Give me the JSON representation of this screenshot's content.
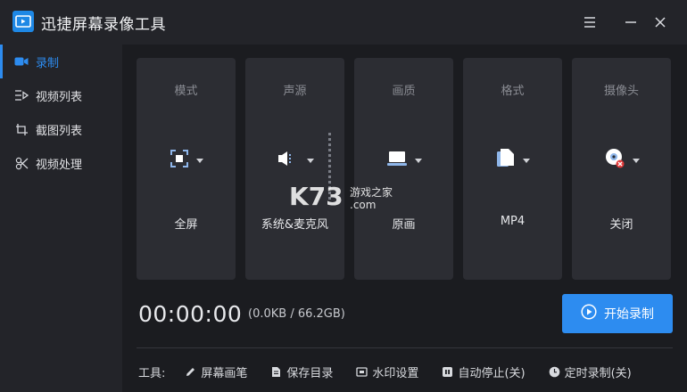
{
  "app": {
    "title": "迅捷屏幕录像工具"
  },
  "sidebar": {
    "items": [
      {
        "label": "录制",
        "icon": "video-camera-icon",
        "active": true
      },
      {
        "label": "视频列表",
        "icon": "video-list-icon",
        "active": false
      },
      {
        "label": "截图列表",
        "icon": "screenshot-list-icon",
        "active": false
      },
      {
        "label": "视频处理",
        "icon": "video-process-icon",
        "active": false
      }
    ]
  },
  "cards": [
    {
      "title": "模式",
      "value": "全屏",
      "icon": "fullscreen-icon"
    },
    {
      "title": "声源",
      "value": "系统&麦克风",
      "icon": "speaker-icon"
    },
    {
      "title": "画质",
      "value": "原画",
      "icon": "monitor-icon"
    },
    {
      "title": "格式",
      "value": "MP4",
      "icon": "file-icon"
    },
    {
      "title": "摄像头",
      "value": "关闭",
      "icon": "webcam-off-icon"
    }
  ],
  "watermark": {
    "brand": "K73",
    "site_cn": "游戏之家",
    "site_domain": ".com"
  },
  "recording": {
    "timer": "00:00:00",
    "storage": "(0.0KB / 66.2GB)",
    "start_label": "开始录制"
  },
  "toolbar": {
    "label": "工具:",
    "tools": [
      {
        "label": "屏幕画笔",
        "icon": "pen-icon"
      },
      {
        "label": "保存目录",
        "icon": "folder-doc-icon"
      },
      {
        "label": "水印设置",
        "icon": "watermark-icon"
      },
      {
        "label": "自动停止(关)",
        "icon": "auto-stop-icon"
      },
      {
        "label": "定时录制(关)",
        "icon": "clock-icon"
      }
    ]
  },
  "colors": {
    "accent": "#2d8cf0",
    "card_bg": "#2c2d33",
    "main_bg": "#1b1c20",
    "sidebar_bg": "#232429"
  }
}
